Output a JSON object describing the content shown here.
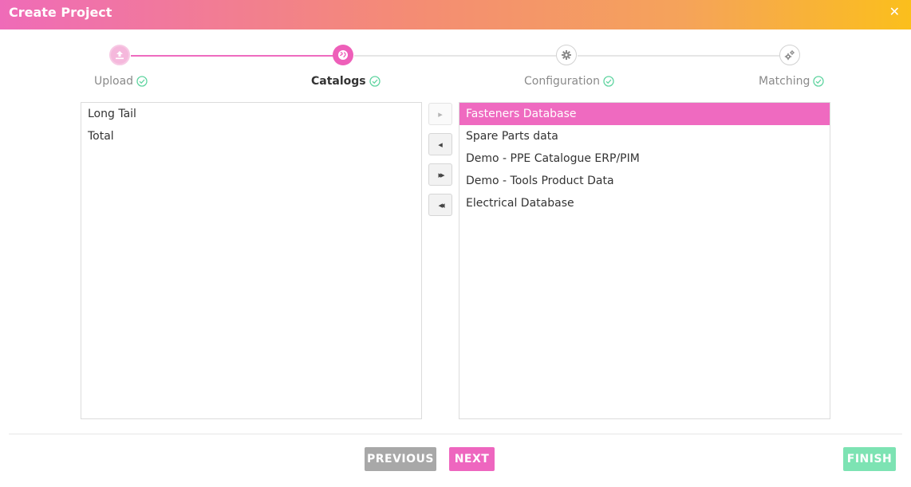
{
  "header": {
    "title": "Create Project",
    "close_label": "✕"
  },
  "stepper": {
    "steps": [
      {
        "label": "Upload",
        "icon": "upload-icon",
        "state": "done"
      },
      {
        "label": "Catalogs",
        "icon": "globe-icon",
        "state": "active"
      },
      {
        "label": "Configuration",
        "icon": "gear-icon",
        "state": "pending"
      },
      {
        "label": "Matching",
        "icon": "gears-icon",
        "state": "pending"
      }
    ]
  },
  "available_list": {
    "items": [
      {
        "label": "Long Tail"
      },
      {
        "label": "Total"
      }
    ]
  },
  "selected_list": {
    "items": [
      {
        "label": "Fasteners Database",
        "selected": true
      },
      {
        "label": "Spare Parts data"
      },
      {
        "label": "Demo - PPE Catalogue ERP/PIM"
      },
      {
        "label": "Demo - Tools Product Data"
      },
      {
        "label": "Electrical Database"
      }
    ]
  },
  "transfer_buttons": {
    "move_right": "▸",
    "move_left": "◂",
    "move_all_right": "▸▸",
    "move_all_left": "◂◂"
  },
  "footer": {
    "previous_label": "PREVIOUS",
    "next_label": "NEXT",
    "finish_label": "FINISH"
  },
  "colors": {
    "accent_pink": "#ee6bbf",
    "success_green": "#5fd4a0",
    "header_gradient_start": "#ef6bb8",
    "header_gradient_end": "#fbbf1c"
  }
}
